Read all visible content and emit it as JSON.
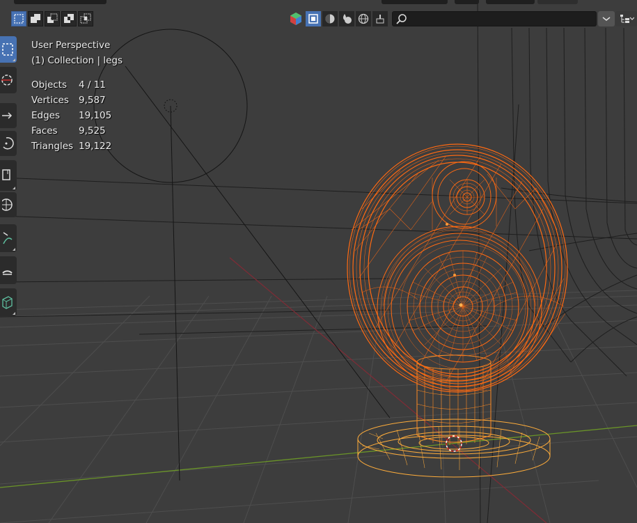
{
  "header": {
    "search": {
      "value": "",
      "placeholder": ""
    },
    "select_modes": [
      "select-new",
      "select-extend",
      "select-subtract",
      "select-intersect"
    ],
    "shading_modes": [
      "overlays",
      "wireframe",
      "solid",
      "material-preview",
      "rendered",
      "retopology"
    ],
    "active_shading": "wireframe"
  },
  "overlay": {
    "view_name": "User Perspective",
    "collection": "(1) Collection | legs"
  },
  "stats": [
    {
      "label": "Objects",
      "value": "4 / 11"
    },
    {
      "label": "Vertices",
      "value": "9,587"
    },
    {
      "label": "Edges",
      "value": "19,105"
    },
    {
      "label": "Faces",
      "value": "9,525"
    },
    {
      "label": "Triangles",
      "value": "19,122"
    }
  ],
  "toolbar": [
    "select-box",
    "cursor",
    "move",
    "rotate",
    "scale",
    "transform",
    "annotate",
    "measure",
    "add-cube"
  ],
  "colors": {
    "background": "#3d3d3d",
    "wire_selected": "#ff6a12",
    "wire_active": "#ffaa33",
    "accent": "#4772b3",
    "x_axis": "#8a2f3a",
    "y_axis": "#6f9a2a"
  }
}
